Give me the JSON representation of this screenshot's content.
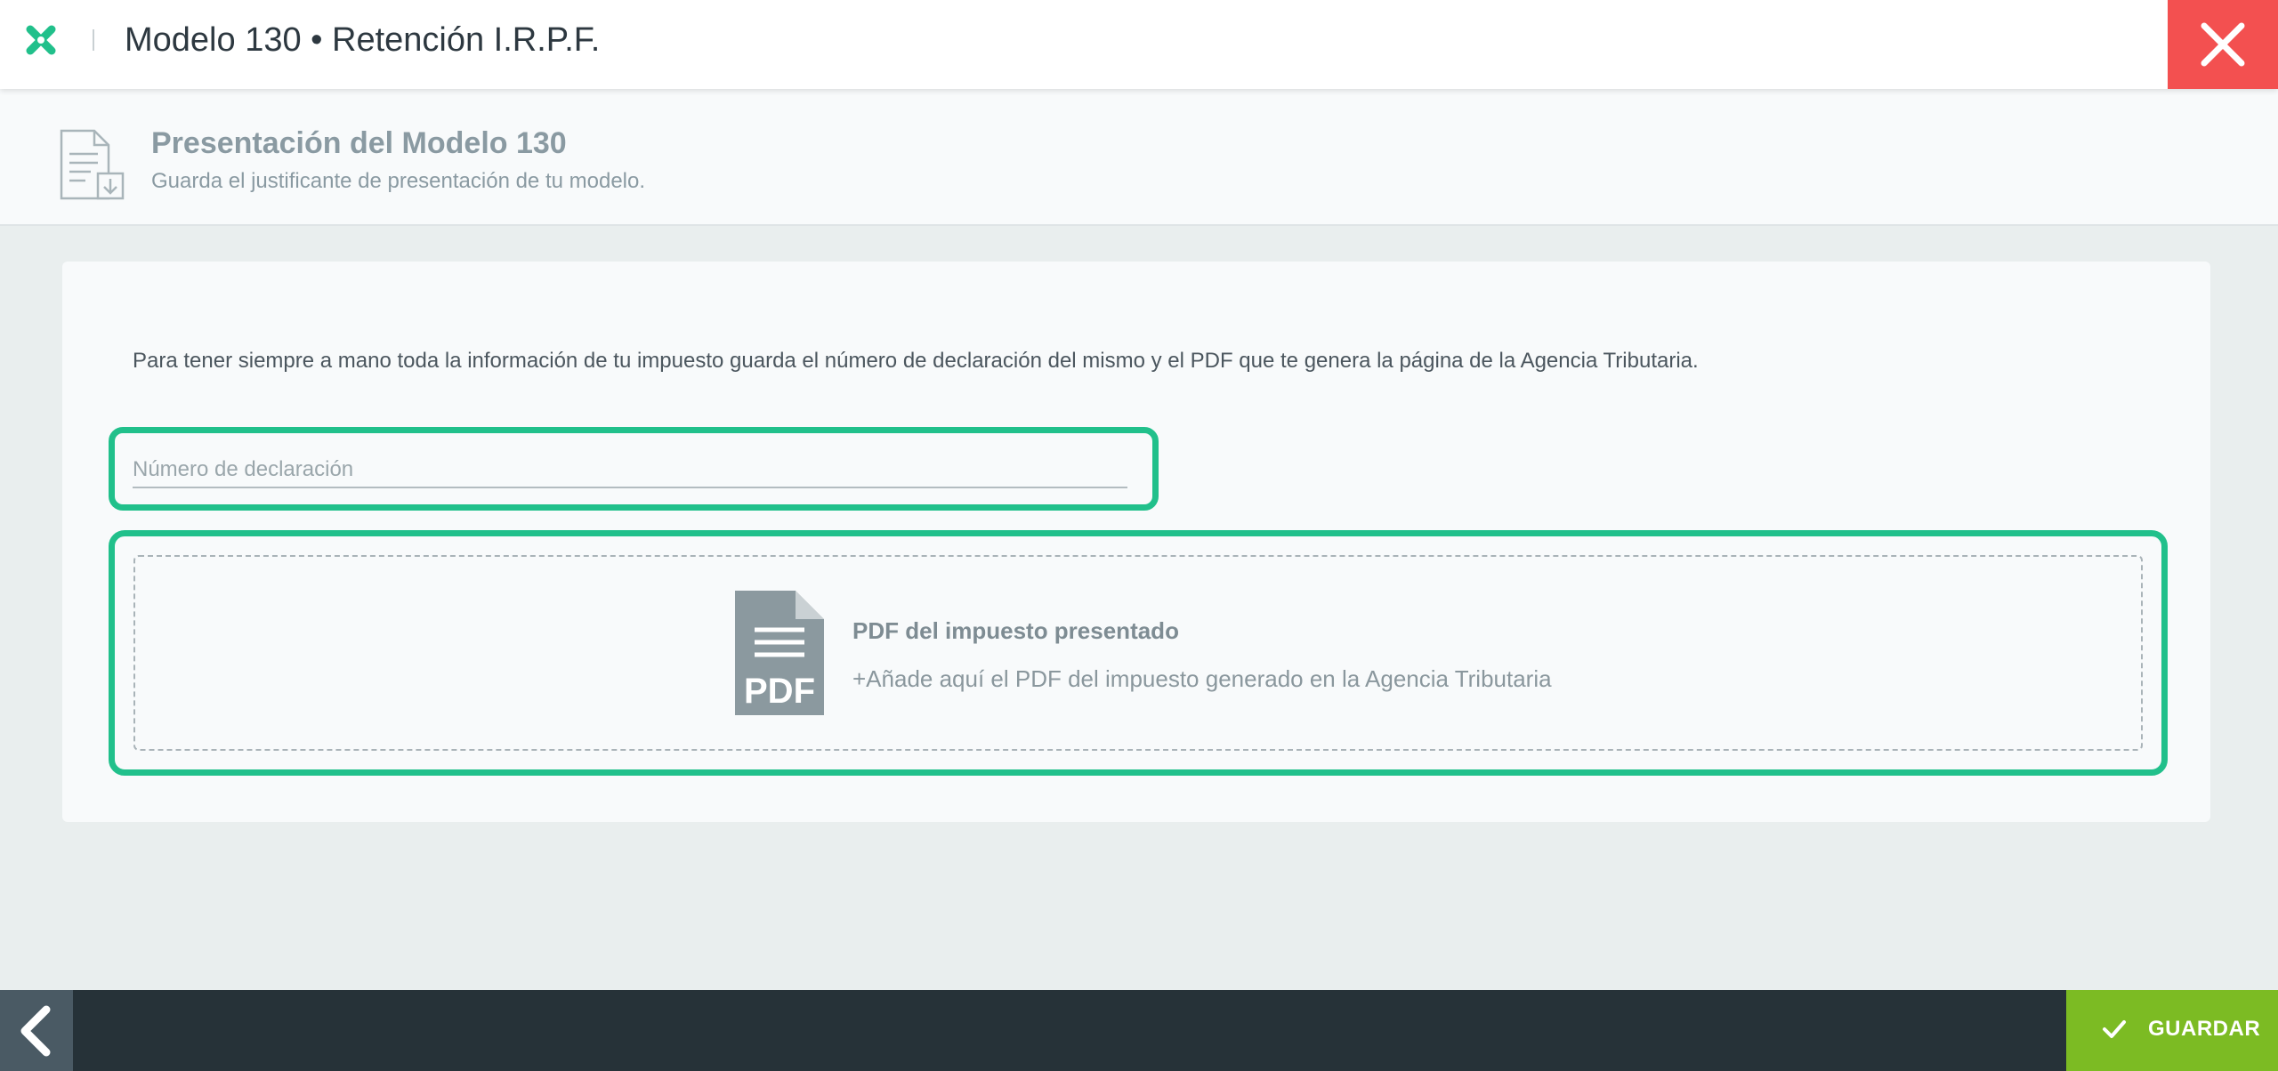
{
  "header": {
    "title": "Modelo 130 • Retención I.R.P.F.",
    "logo_icon": "app-logo-x-icon",
    "close_icon": "close-icon",
    "accent_color": "#21c08b",
    "close_color": "#f35050"
  },
  "section": {
    "title": "Presentación del Modelo 130",
    "subtitle": "Guarda el justificante de presentación de tu modelo.",
    "icon": "document-download-icon"
  },
  "main": {
    "info_text": "Para tener siempre a mano toda la información de tu impuesto guarda el número de declaración del mismo y el PDF que te genera la página de la Agencia Tributaria.",
    "declaration_input": {
      "placeholder": "Número de declaración",
      "value": ""
    },
    "upload": {
      "icon": "pdf-file-icon",
      "icon_label": "PDF",
      "title": "PDF del impuesto presentado",
      "subtitle": "+Añade aquí el PDF del impuesto generado en la Agencia Tributaria"
    }
  },
  "footer": {
    "back_icon": "chevron-left-icon",
    "save_icon": "check-icon",
    "save_label": "GUARDAR",
    "save_color": "#7cbb23"
  }
}
